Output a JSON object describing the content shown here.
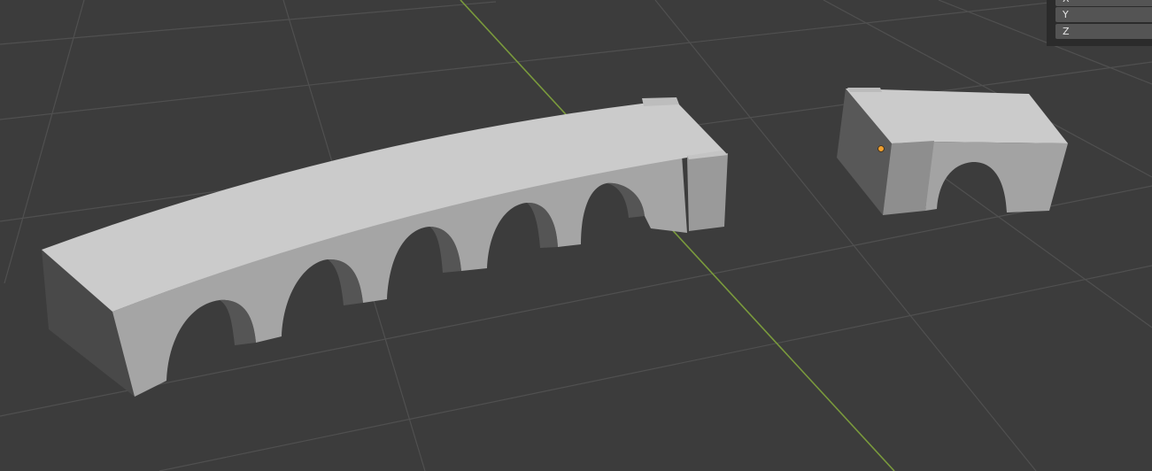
{
  "viewport": {
    "background_color": "#3c3c3c",
    "grid_color": "#4e4e4e",
    "y_axis_line_color": "#7a9a3c",
    "mesh_top_color": "#cfcfcf",
    "mesh_side_color": "#9c9c9c",
    "origin_dot_color": "#f0a030"
  },
  "transform_panel": {
    "fields": [
      {
        "label": "X"
      },
      {
        "label": "Y"
      },
      {
        "label": "Z"
      }
    ]
  }
}
